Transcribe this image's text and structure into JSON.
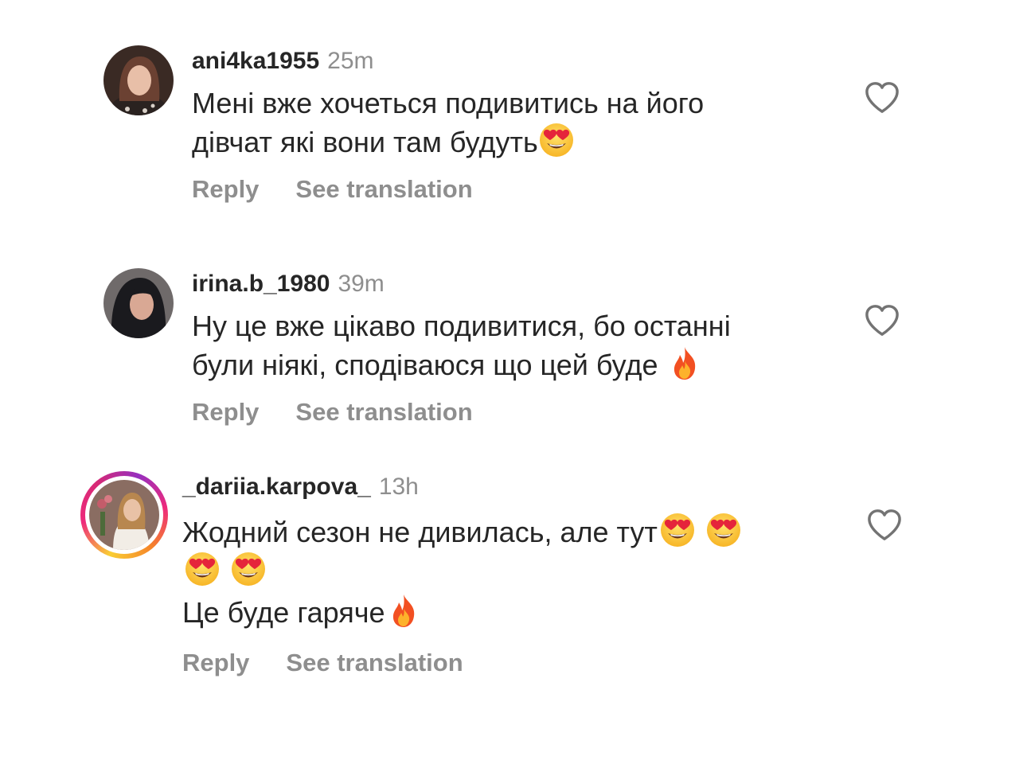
{
  "comments": [
    {
      "username": "ani4ka1955",
      "time": "25m",
      "line1": "Мені  вже хочеться подивитись на його",
      "line2": "дівчат які вони там будуть",
      "reply": "Reply",
      "translate": "See translation"
    },
    {
      "username": "irina.b_1980",
      "time": "39m",
      "line1": "Ну це вже цікаво подивитися, бо останні",
      "line2": "були ніякі, сподіваюся що цей буде ",
      "reply": "Reply",
      "translate": "See translation"
    },
    {
      "username": "_dariia.karpova_",
      "time": "13h",
      "line1": "Жодний сезон не дивилась, але тут",
      "line3": "Це буде гаряче",
      "reply": "Reply",
      "translate": "See translation"
    }
  ],
  "colors": {
    "text": "#262626",
    "secondary": "#8e8e8e",
    "story_ring": [
      "#f9ce34",
      "#ee2a7b",
      "#962fbf"
    ]
  },
  "icons": [
    "heart-outline-icon",
    "heart-eyes-emoji",
    "fire-emoji"
  ]
}
